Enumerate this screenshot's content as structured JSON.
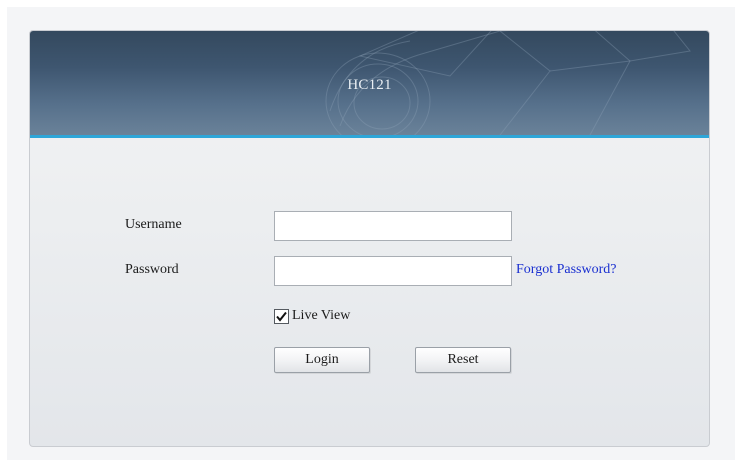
{
  "header": {
    "device_title": "HC121"
  },
  "form": {
    "username_label": "Username",
    "username_value": "",
    "username_placeholder": "",
    "password_label": "Password",
    "password_value": "",
    "password_placeholder": "",
    "forgot_password_label": "Forgot Password?",
    "live_view_label": "Live View",
    "live_view_checked": true,
    "login_label": "Login",
    "reset_label": "Reset"
  },
  "colors": {
    "banner": "#3e5670",
    "accent_line": "#2ea6d8",
    "link": "#1a2fd0",
    "panel_bg": "#eceef0"
  },
  "icons": {
    "checkbox": "checkmark-icon",
    "banner_art": "camera-lens-icon"
  }
}
